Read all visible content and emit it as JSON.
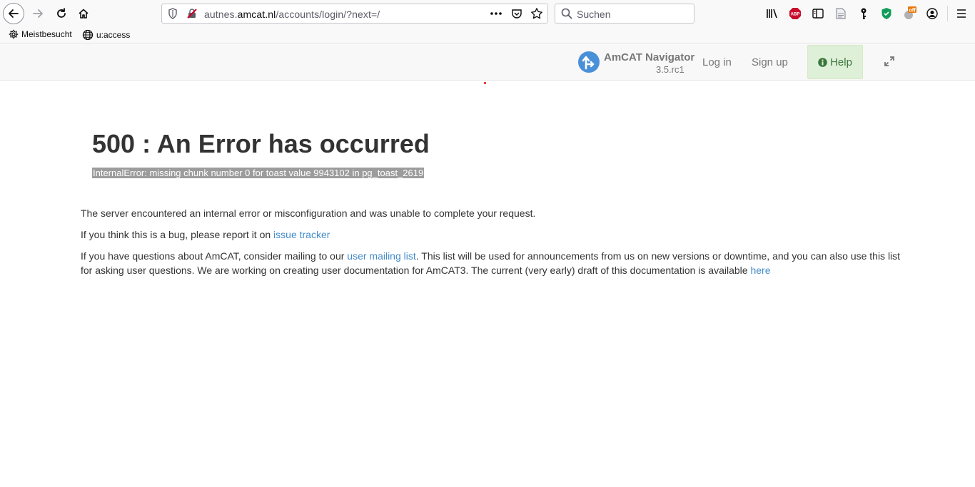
{
  "browser": {
    "url_prefix": "autnes.",
    "url_domain": "amcat.nl",
    "url_path": "/accounts/login/?next=/",
    "search_placeholder": "Suchen",
    "bookmarks": [
      {
        "label": "Meistbesucht",
        "icon": "gear-icon"
      },
      {
        "label": "u:access",
        "icon": "globe-icon"
      }
    ],
    "extension_badge": "off"
  },
  "navbar": {
    "brand_name": "AmCAT Navigator",
    "version": "3.5.rc1",
    "login_label": "Log in",
    "signup_label": "Sign up",
    "help_label": "Help"
  },
  "error": {
    "title": "500 : An Error has occurred",
    "detail": "InternalError: missing chunk number 0 for toast value 9943102 in pg_toast_2619",
    "para1": "The server encountered an internal error or misconfiguration and was unable to complete your request.",
    "para2_text": "If you think this is a bug, please report it on ",
    "para2_link": "issue tracker",
    "para3_text_a": "If you have questions about AmCAT, consider mailing to our ",
    "para3_link": "user mailing list",
    "para3_text_b": ". This list will be used for announcements from us on new versions or downtime, and you can also use this list for asking user questions. We are working on creating user documentation for AmCAT3. The current (very early) draft of this documentation is available ",
    "para3_link2": "here"
  },
  "colors": {
    "link": "#428bca",
    "help_bg": "#dff0d8",
    "help_text": "#3c763d",
    "detail_bg": "#9c9c9c"
  }
}
